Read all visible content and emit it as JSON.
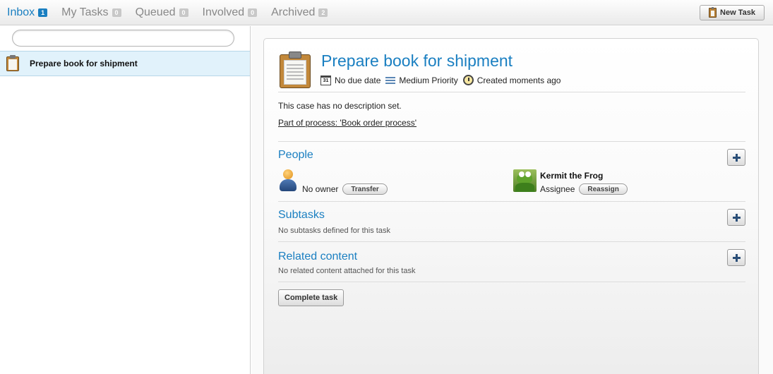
{
  "tabs": [
    {
      "label": "Inbox",
      "count": "1",
      "active": true
    },
    {
      "label": "My Tasks",
      "count": "0"
    },
    {
      "label": "Queued",
      "count": "0"
    },
    {
      "label": "Involved",
      "count": "0"
    },
    {
      "label": "Archived",
      "count": "2"
    }
  ],
  "toolbar": {
    "new_task_label": "New Task"
  },
  "search": {
    "value": "",
    "placeholder": ""
  },
  "task_list": [
    {
      "label": "Prepare book for shipment",
      "selected": true
    }
  ],
  "task": {
    "title": "Prepare book for shipment",
    "calendar_day": "31",
    "due": "No due date",
    "priority": "Medium Priority",
    "created": "Created moments ago",
    "description": "This case has no description set.",
    "process_link": "Part of process: 'Book order process'"
  },
  "people": {
    "title": "People",
    "owner": "No owner",
    "transfer_label": "Transfer",
    "assignee_name": "Kermit the Frog",
    "assignee_role": "Assignee",
    "reassign_label": "Reassign"
  },
  "subtasks": {
    "title": "Subtasks",
    "note": "No subtasks defined for this task"
  },
  "related": {
    "title": "Related content",
    "note": "No related content attached for this task"
  },
  "actions": {
    "complete_label": "Complete task"
  },
  "colors": {
    "accent": "#1a7fc1",
    "selected_row": "#e1f2fb",
    "tab_inactive": "#888888"
  }
}
